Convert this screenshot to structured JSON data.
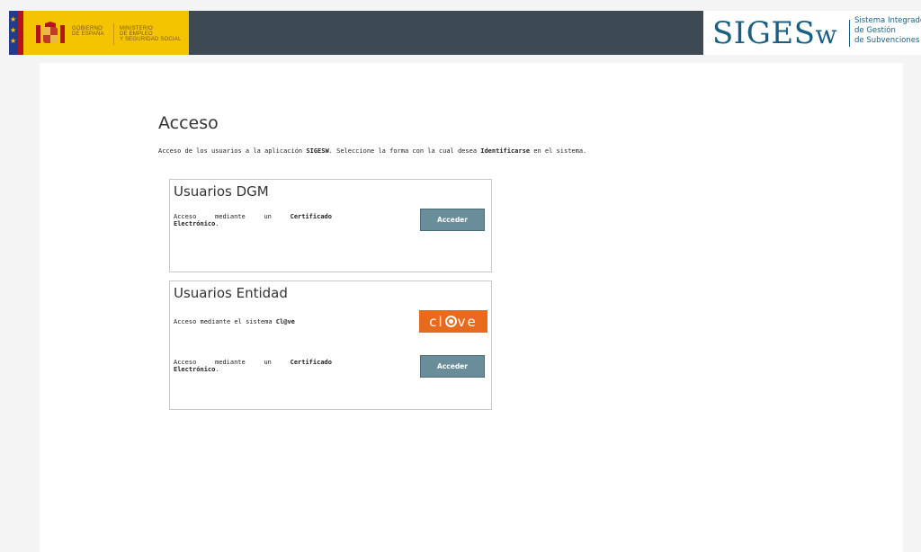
{
  "header": {
    "gov_line1": "GOBIERNO",
    "gov_line2": "DE ESPAÑA",
    "ministry_line1": "MINISTERIO",
    "ministry_line2": "DE EMPLEO",
    "ministry_line3": "Y SEGURIDAD SOCIAL",
    "app_logo": "SIGES",
    "app_logo_w": "w",
    "app_desc_line1": "Sistema Integrado",
    "app_desc_line2": "de Gestión",
    "app_desc_line3": "de Subvenciones"
  },
  "main": {
    "title": "Acceso",
    "intro_pre": "Acceso de los usuarios a la aplicación ",
    "intro_app": "SIGESW",
    "intro_mid": ". Seleccione la forma con la cual desea ",
    "intro_bold": "Identificarse",
    "intro_post": " en el sistema."
  },
  "dgm_box": {
    "title": "Usuarios DGM",
    "cert_word1": "Acceso",
    "cert_word2": "mediante",
    "cert_word3": "un",
    "cert_word4": "Certificado",
    "cert_word5": "Electrónico",
    "cert_end": ".",
    "button_label": "Acceder"
  },
  "entity_box": {
    "title": "Usuarios Entidad",
    "clave_pre": "Acceso mediante el sistema ",
    "clave_name": "Cl@ve",
    "clave_logo_c": "cl",
    "clave_logo_ve": "ve",
    "cert_word1": "Acceso",
    "cert_word2": "mediante",
    "cert_word3": "un",
    "cert_word4": "Certificado",
    "cert_word5": "Electrónico",
    "cert_end": ".",
    "button_label": "Acceder"
  },
  "colors": {
    "header_bg": "#3d4a53",
    "gov_yellow": "#f5c400",
    "brand_blue": "#1a5f82",
    "button_bg": "#6a8d9a",
    "clave_orange": "#e86a1c"
  }
}
